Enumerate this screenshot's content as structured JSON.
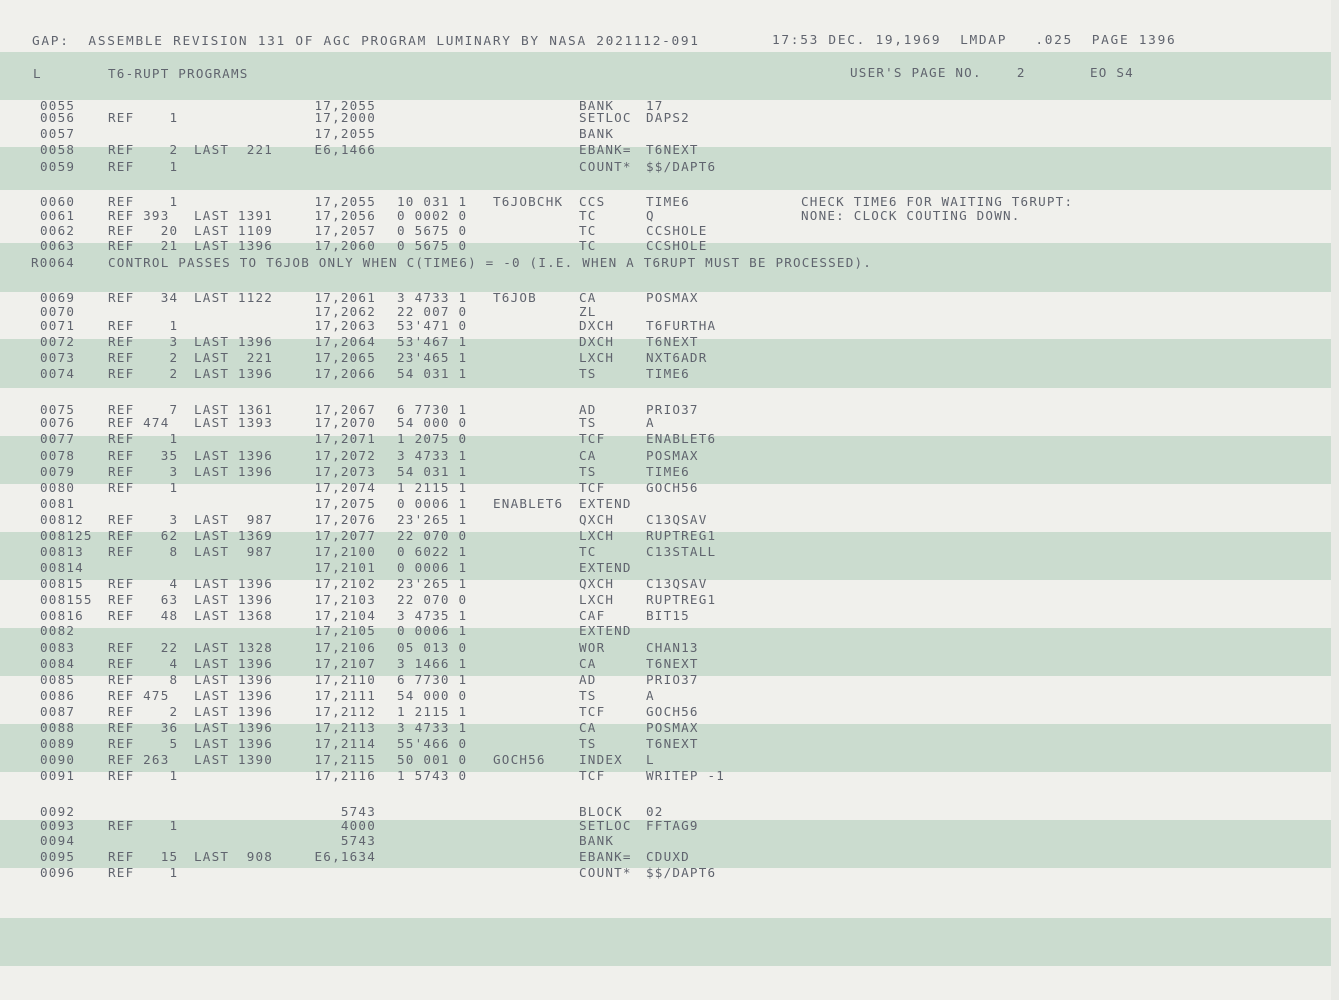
{
  "header": {
    "title": "GAP:  ASSEMBLE REVISION 131 OF AGC PROGRAM LUMINARY BY NASA 2021112-091",
    "stamp": "17:53 DEC. 19,1969  LMDAP   .025  PAGE 1396"
  },
  "subheader": {
    "l": "L",
    "section": "T6-RUPT PROGRAMS",
    "users_page": "USER'S PAGE NO.    2",
    "eo": "EO S4"
  },
  "listing": [
    {
      "ln": "0055",
      "ref": "",
      "last": "",
      "addr": "17,2055",
      "code": "",
      "label": "",
      "op": "BANK",
      "operand": "17"
    },
    {
      "ln": "0056",
      "ref": "REF    1",
      "last": "",
      "addr": "17,2000",
      "code": "",
      "label": "",
      "op": "SETLOC",
      "operand": "DAPS2"
    },
    {
      "ln": "0057",
      "ref": "",
      "last": "",
      "addr": "17,2055",
      "code": "",
      "label": "",
      "op": "BANK",
      "operand": ""
    },
    {
      "ln": "0058",
      "ref": "REF    2",
      "last": "LAST  221",
      "addr": "E6,1466",
      "code": "",
      "label": "",
      "op": "EBANK=",
      "operand": "T6NEXT"
    },
    {
      "ln": "0059",
      "ref": "REF    1",
      "last": "",
      "addr": "",
      "code": "",
      "label": "",
      "op": "COUNT*",
      "operand": "$$/DAPT6"
    },
    {
      "ln": "0060",
      "ref": "REF    1",
      "last": "",
      "addr": "17,2055",
      "code": "10 031 1",
      "label": "T6JOBCHK",
      "op": "CCS",
      "operand": "TIME6",
      "comment": "CHECK TIME6 FOR WAITING T6RUPT:"
    },
    {
      "ln": "0061",
      "ref": "REF 393",
      "last": "LAST 1391",
      "addr": "17,2056",
      "code": "0 0002 0",
      "label": "",
      "op": "TC",
      "operand": "Q",
      "comment": "NONE: CLOCK COUTING DOWN."
    },
    {
      "ln": "0062",
      "ref": "REF   20",
      "last": "LAST 1109",
      "addr": "17,2057",
      "code": "0 5675 0",
      "label": "",
      "op": "TC",
      "operand": "CCSHOLE"
    },
    {
      "ln": "0063",
      "ref": "REF   21",
      "last": "LAST 1396",
      "addr": "17,2060",
      "code": "0 5675 0",
      "label": "",
      "op": "TC",
      "operand": "CCSHOLE"
    },
    {
      "ln": "0069",
      "ref": "REF   34",
      "last": "LAST 1122",
      "addr": "17,2061",
      "code": "3 4733 1",
      "label": "T6JOB",
      "op": "CA",
      "operand": "POSMAX"
    },
    {
      "ln": "0070",
      "ref": "",
      "last": "",
      "addr": "17,2062",
      "code": "22 007 0",
      "label": "",
      "op": "ZL",
      "operand": ""
    },
    {
      "ln": "0071",
      "ref": "REF    1",
      "last": "",
      "addr": "17,2063",
      "code": "53'471 0",
      "label": "",
      "op": "DXCH",
      "operand": "T6FURTHA"
    },
    {
      "ln": "0072",
      "ref": "REF    3",
      "last": "LAST 1396",
      "addr": "17,2064",
      "code": "53'467 1",
      "label": "",
      "op": "DXCH",
      "operand": "T6NEXT"
    },
    {
      "ln": "0073",
      "ref": "REF    2",
      "last": "LAST  221",
      "addr": "17,2065",
      "code": "23'465 1",
      "label": "",
      "op": "LXCH",
      "operand": "NXT6ADR"
    },
    {
      "ln": "0074",
      "ref": "REF    2",
      "last": "LAST 1396",
      "addr": "17,2066",
      "code": "54 031 1",
      "label": "",
      "op": "TS",
      "operand": "TIME6"
    },
    {
      "ln": "0075",
      "ref": "REF    7",
      "last": "LAST 1361",
      "addr": "17,2067",
      "code": "6 7730 1",
      "label": "",
      "op": "AD",
      "operand": "PRIO37"
    },
    {
      "ln": "0076",
      "ref": "REF 474",
      "last": "LAST 1393",
      "addr": "17,2070",
      "code": "54 000 0",
      "label": "",
      "op": "TS",
      "operand": "A"
    },
    {
      "ln": "0077",
      "ref": "REF    1",
      "last": "",
      "addr": "17,2071",
      "code": "1 2075 0",
      "label": "",
      "op": "TCF",
      "operand": "ENABLET6"
    },
    {
      "ln": "0078",
      "ref": "REF   35",
      "last": "LAST 1396",
      "addr": "17,2072",
      "code": "3 4733 1",
      "label": "",
      "op": "CA",
      "operand": "POSMAX"
    },
    {
      "ln": "0079",
      "ref": "REF    3",
      "last": "LAST 1396",
      "addr": "17,2073",
      "code": "54 031 1",
      "label": "",
      "op": "TS",
      "operand": "TIME6"
    },
    {
      "ln": "0080",
      "ref": "REF    1",
      "last": "",
      "addr": "17,2074",
      "code": "1 2115 1",
      "label": "",
      "op": "TCF",
      "operand": "GOCH56"
    },
    {
      "ln": "0081",
      "ref": "",
      "last": "",
      "addr": "17,2075",
      "code": "0 0006 1",
      "label": "ENABLET6",
      "op": "EXTEND",
      "operand": ""
    },
    {
      "ln": "00812",
      "ref": "REF    3",
      "last": "LAST  987",
      "addr": "17,2076",
      "code": "23'265 1",
      "label": "",
      "op": "QXCH",
      "operand": "C13QSAV"
    },
    {
      "ln": "008125",
      "ref": "REF   62",
      "last": "LAST 1369",
      "addr": "17,2077",
      "code": "22 070 0",
      "label": "",
      "op": "LXCH",
      "operand": "RUPTREG1"
    },
    {
      "ln": "00813",
      "ref": "REF    8",
      "last": "LAST  987",
      "addr": "17,2100",
      "code": "0 6022 1",
      "label": "",
      "op": "TC",
      "operand": "C13STALL"
    },
    {
      "ln": "00814",
      "ref": "",
      "last": "",
      "addr": "17,2101",
      "code": "0 0006 1",
      "label": "",
      "op": "EXTEND",
      "operand": ""
    },
    {
      "ln": "00815",
      "ref": "REF    4",
      "last": "LAST 1396",
      "addr": "17,2102",
      "code": "23'265 1",
      "label": "",
      "op": "QXCH",
      "operand": "C13QSAV"
    },
    {
      "ln": "008155",
      "ref": "REF   63",
      "last": "LAST 1396",
      "addr": "17,2103",
      "code": "22 070 0",
      "label": "",
      "op": "LXCH",
      "operand": "RUPTREG1"
    },
    {
      "ln": "00816",
      "ref": "REF   48",
      "last": "LAST 1368",
      "addr": "17,2104",
      "code": "3 4735 1",
      "label": "",
      "op": "CAF",
      "operand": "BIT15"
    },
    {
      "ln": "0082",
      "ref": "",
      "last": "",
      "addr": "17,2105",
      "code": "0 0006 1",
      "label": "",
      "op": "EXTEND",
      "operand": ""
    },
    {
      "ln": "0083",
      "ref": "REF   22",
      "last": "LAST 1328",
      "addr": "17,2106",
      "code": "05 013 0",
      "label": "",
      "op": "WOR",
      "operand": "CHAN13"
    },
    {
      "ln": "0084",
      "ref": "REF    4",
      "last": "LAST 1396",
      "addr": "17,2107",
      "code": "3 1466 1",
      "label": "",
      "op": "CA",
      "operand": "T6NEXT"
    },
    {
      "ln": "0085",
      "ref": "REF    8",
      "last": "LAST 1396",
      "addr": "17,2110",
      "code": "6 7730 1",
      "label": "",
      "op": "AD",
      "operand": "PRIO37"
    },
    {
      "ln": "0086",
      "ref": "REF 475",
      "last": "LAST 1396",
      "addr": "17,2111",
      "code": "54 000 0",
      "label": "",
      "op": "TS",
      "operand": "A"
    },
    {
      "ln": "0087",
      "ref": "REF    2",
      "last": "LAST 1396",
      "addr": "17,2112",
      "code": "1 2115 1",
      "label": "",
      "op": "TCF",
      "operand": "GOCH56"
    },
    {
      "ln": "0088",
      "ref": "REF   36",
      "last": "LAST 1396",
      "addr": "17,2113",
      "code": "3 4733 1",
      "label": "",
      "op": "CA",
      "operand": "POSMAX"
    },
    {
      "ln": "0089",
      "ref": "REF    5",
      "last": "LAST 1396",
      "addr": "17,2114",
      "code": "55'466 0",
      "label": "",
      "op": "TS",
      "operand": "T6NEXT"
    },
    {
      "ln": "0090",
      "ref": "REF 263",
      "last": "LAST 1390",
      "addr": "17,2115",
      "code": "50 001 0",
      "label": "GOCH56",
      "op": "INDEX",
      "operand": "L"
    },
    {
      "ln": "0091",
      "ref": "REF    1",
      "last": "",
      "addr": "17,2116",
      "code": "1 5743 0",
      "label": "",
      "op": "TCF",
      "operand": "WRITEP -1"
    },
    {
      "ln": "0092",
      "ref": "",
      "last": "",
      "addr": "5743",
      "code": "",
      "label": "",
      "op": "BLOCK",
      "operand": "02"
    },
    {
      "ln": "0093",
      "ref": "REF    1",
      "last": "",
      "addr": "4000",
      "code": "",
      "label": "",
      "op": "SETLOC",
      "operand": "FFTAG9"
    },
    {
      "ln": "0094",
      "ref": "",
      "last": "",
      "addr": "5743",
      "code": "",
      "label": "",
      "op": "BANK",
      "operand": ""
    },
    {
      "ln": "0095",
      "ref": "REF   15",
      "last": "LAST  908",
      "addr": "E6,1634",
      "code": "",
      "label": "",
      "op": "EBANK=",
      "operand": "CDUXD"
    },
    {
      "ln": "0096",
      "ref": "REF    1",
      "last": "",
      "addr": "",
      "code": "",
      "label": "",
      "op": "COUNT*",
      "operand": "$$/DAPT6"
    }
  ],
  "remark": {
    "ln": "R0064",
    "text": "CONTROL PASSES TO T6JOB ONLY WHEN C(TIME6) = -0 (I.E. WHEN A T6RUPT MUST BE PROCESSED)."
  }
}
